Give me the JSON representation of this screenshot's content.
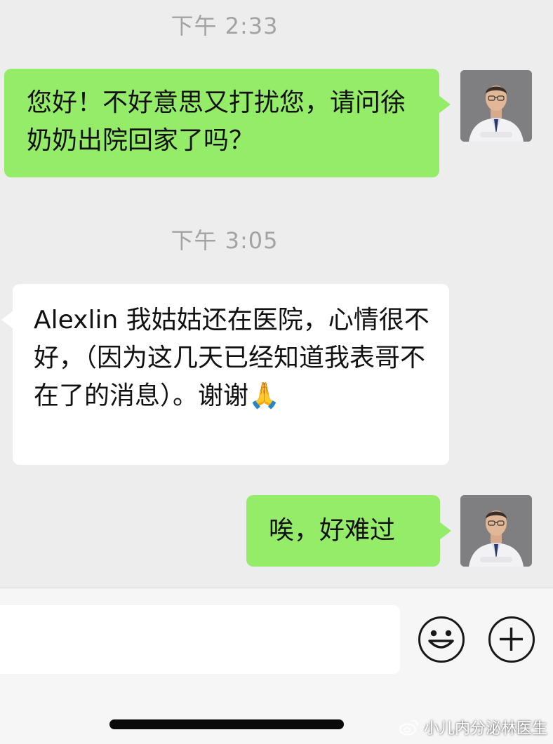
{
  "chat": {
    "timestamps": [
      "下午 2:33",
      "下午 3:05"
    ],
    "messages": [
      {
        "side": "sent",
        "text": "您好！不好意思又打扰您，请问徐奶奶出院回家了吗？"
      },
      {
        "side": "received",
        "text": "Alexlin 我姑姑还在医院，心情很不好，（因为这几天已经知道我表哥不在了的消息）。谢谢🙏"
      },
      {
        "side": "sent",
        "text": "唉，好难过"
      }
    ]
  },
  "input_bar": {
    "buttons": [
      {
        "icon": "emoji-smile-icon"
      },
      {
        "icon": "plus-circle-icon"
      }
    ]
  },
  "watermark": {
    "text": "小儿内分泌林医生",
    "icon": "weibo-logo-icon"
  },
  "colors": {
    "sent_bubble": "#95ec69",
    "received_bubble": "#ffffff",
    "background": "#ededed"
  }
}
